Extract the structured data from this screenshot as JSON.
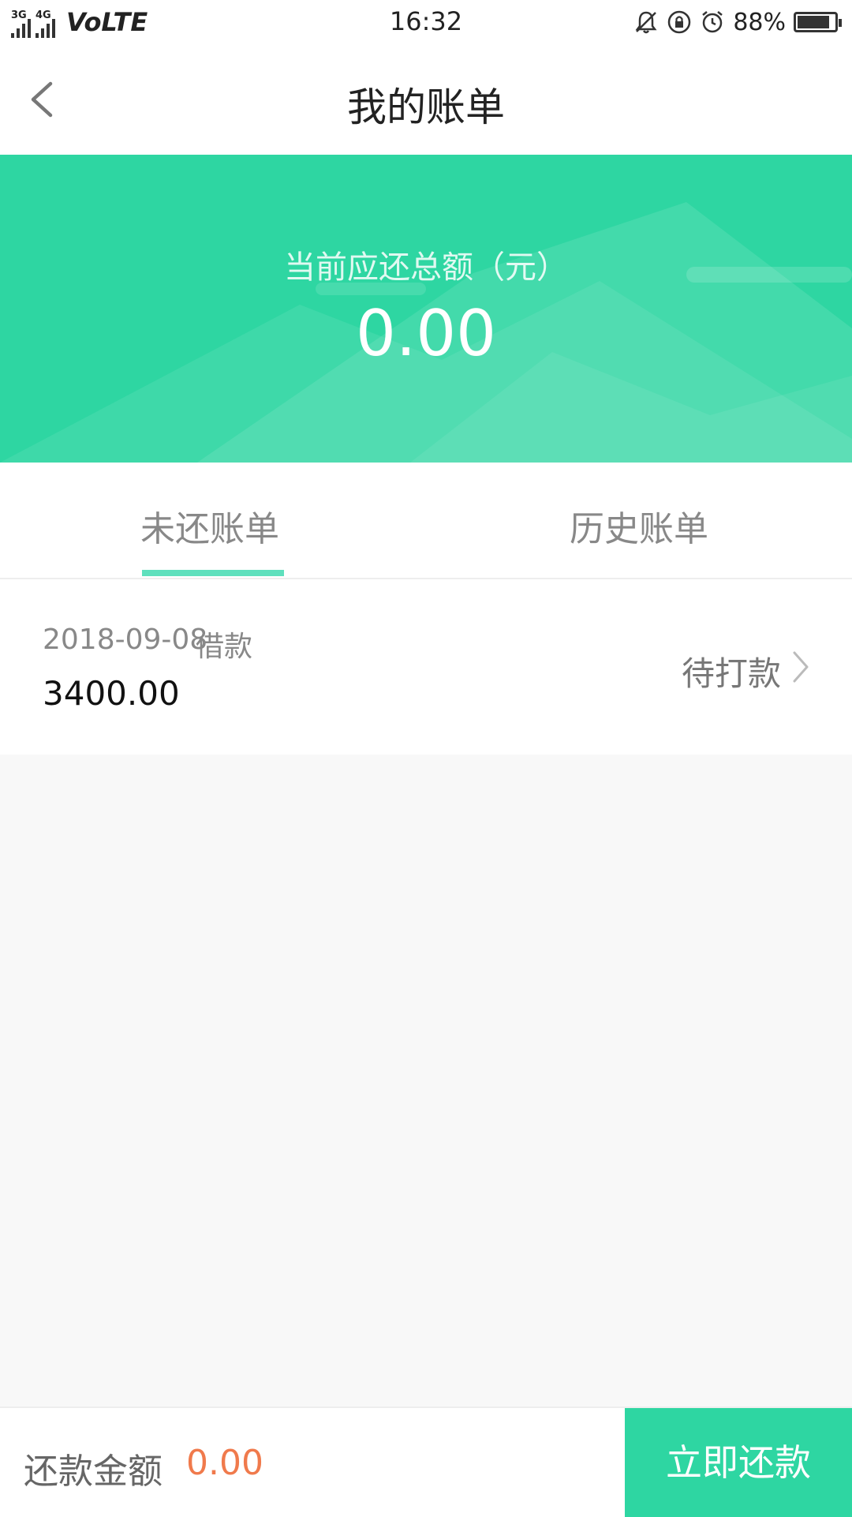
{
  "statusbar": {
    "net1": "3G",
    "net2": "4G",
    "volte": "VoLTE",
    "time": "16:32",
    "battery_pct": "88%",
    "battery_level": 0.88,
    "icons": [
      "bell-off-icon",
      "rotation-lock-icon",
      "alarm-icon",
      "battery-icon"
    ]
  },
  "header": {
    "title": "我的账单",
    "back_icon": "back-chevron-icon"
  },
  "summary": {
    "label": "当前应还总额（元）",
    "amount": "0.00"
  },
  "tabs": [
    {
      "label": "未还账单",
      "active": true
    },
    {
      "label": "历史账单",
      "active": false
    }
  ],
  "bills": [
    {
      "date": "2018-09-08",
      "type": "借款",
      "amount": "3400.00",
      "status": "待打款"
    }
  ],
  "footer": {
    "label": "还款金额",
    "amount": "0.00",
    "button": "立即还款"
  },
  "colors": {
    "accent": "#2ed6a2",
    "tab_indicator": "#5fe0bd",
    "amount_orange": "#f07a4c"
  }
}
